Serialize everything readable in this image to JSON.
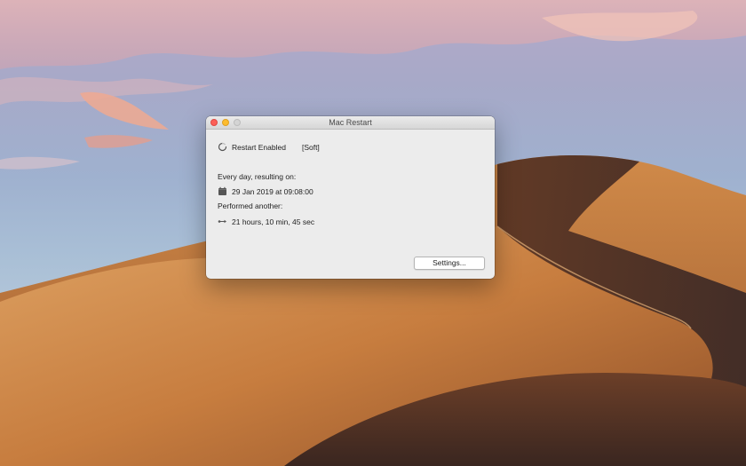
{
  "window": {
    "title": "Mac Restart"
  },
  "status": {
    "icon": "spinner-icon",
    "label": "Restart Enabled",
    "mode": "[Soft]"
  },
  "schedule": {
    "frequency_label": "Every day, resulting on:",
    "date_icon": "calendar-icon",
    "next_restart": "29 Jan 2019 at 09:08:00",
    "performed_label": "Performed another:",
    "countdown_icon": "arrows-icon",
    "time_remaining": "21 hours, 10 min, 45 sec"
  },
  "buttons": {
    "settings_label": "Settings..."
  },
  "colors": {
    "close": "#fc5f57",
    "minimize": "#fdbc2e",
    "zoom_disabled": "#d4d4d4",
    "window_bg": "#ececec"
  }
}
